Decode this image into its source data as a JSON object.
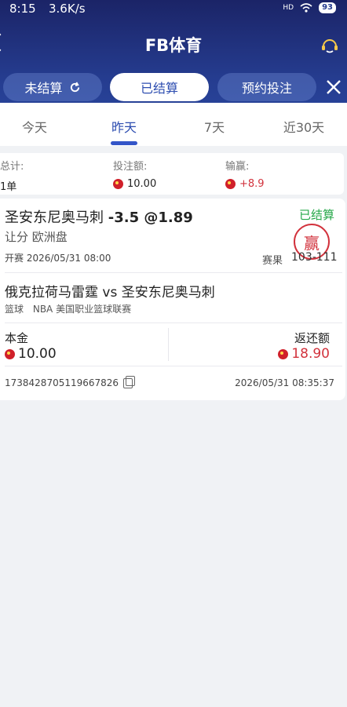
{
  "status": {
    "time": "8:15",
    "speed": "3.6K/s",
    "battery": "93",
    "network": "HD"
  },
  "header": {
    "title": "FB体育"
  },
  "tabs": [
    {
      "label": "未结算",
      "active": false
    },
    {
      "label": "已结算",
      "active": true
    },
    {
      "label": "预约投注",
      "active": false
    }
  ],
  "days": [
    "今天",
    "昨天",
    "7天",
    "近30天"
  ],
  "summary": {
    "total_label": "总计:",
    "total_value": "1单",
    "stake_label": "投注额:",
    "stake_value": "10.00",
    "win_label": "输赢:",
    "win_value": "+8.9"
  },
  "bet": {
    "selection": "圣安东尼奥马刺",
    "line": "-3.5 @1.89",
    "status": "已结算",
    "market": "让分  欧洲盘",
    "start_label": "开赛",
    "start_time": "2026/05/31 08:00",
    "score_label": "赛果",
    "score": "103-111",
    "stamp_text": "赢",
    "match": "俄克拉荷马雷霆 vs 圣安东尼奥马刺",
    "sport": "篮球",
    "league": "NBA 美国职业篮球联赛",
    "principal_label": "本金",
    "principal_value": "10.00",
    "return_label": "返还额",
    "return_value": "18.90",
    "order_id": "1738428705119667826",
    "settle_time": "2026/05/31 08:35:37"
  },
  "colors": {
    "primary": "#2d4db0",
    "header_dark": "#1b2467",
    "win_green": "#27a84a",
    "red": "#d2323c"
  }
}
